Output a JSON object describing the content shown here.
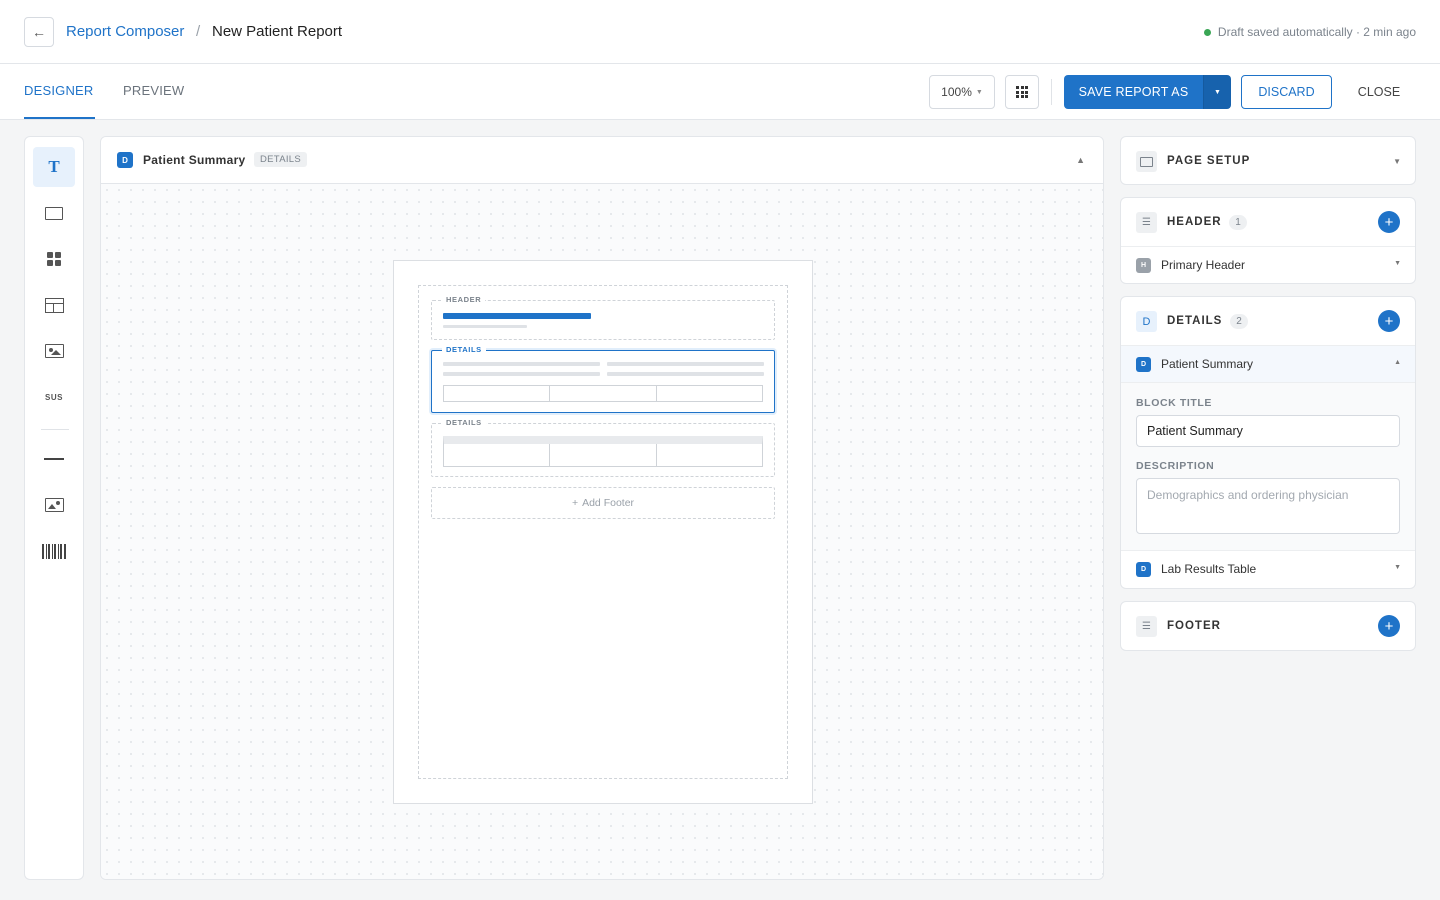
{
  "breadcrumb": {
    "root": "Report Composer",
    "separator": "/",
    "current": "New Patient Report"
  },
  "draft_status": "Draft saved automatically · 2 min ago",
  "tabs": [
    {
      "label": "DESIGNER",
      "active": true
    },
    {
      "label": "PREVIEW",
      "active": false
    }
  ],
  "toolbar": {
    "zoom": "100%",
    "save_label": "SAVE REPORT AS",
    "discard_label": "DISCARD",
    "close_label": "CLOSE"
  },
  "tool_rail": {
    "text_glyph": "T",
    "sus_label": "SUS"
  },
  "canvas": {
    "block_badge": "D",
    "block_title": "Patient Summary",
    "block_chip": "DETAILS",
    "bands": {
      "header_label": "HEADER",
      "details_label_1": "DETAILS",
      "details_label_2": "DETAILS",
      "add_footer_icon": "+",
      "add_footer_label": "Add Footer"
    }
  },
  "right_panel": {
    "page_setup": {
      "title": "PAGE SETUP"
    },
    "header": {
      "icon": "☰",
      "title": "HEADER",
      "count": "1",
      "items": [
        {
          "badge": "H",
          "label": "Primary Header"
        }
      ]
    },
    "details": {
      "icon": "D",
      "title": "DETAILS",
      "count": "2",
      "items": [
        {
          "badge": "D",
          "label": "Patient Summary"
        },
        {
          "badge": "D",
          "label": "Lab Results Table"
        }
      ],
      "form": {
        "block_title_label": "BLOCK TITLE",
        "block_title_value": "Patient Summary",
        "description_label": "DESCRIPTION",
        "description_placeholder": "Demographics and ordering physician"
      }
    },
    "footer": {
      "icon": "☰",
      "title": "FOOTER"
    },
    "add_icon": "+"
  },
  "colors": {
    "accent": "#1f73c8",
    "status_ok": "#3aa655"
  }
}
